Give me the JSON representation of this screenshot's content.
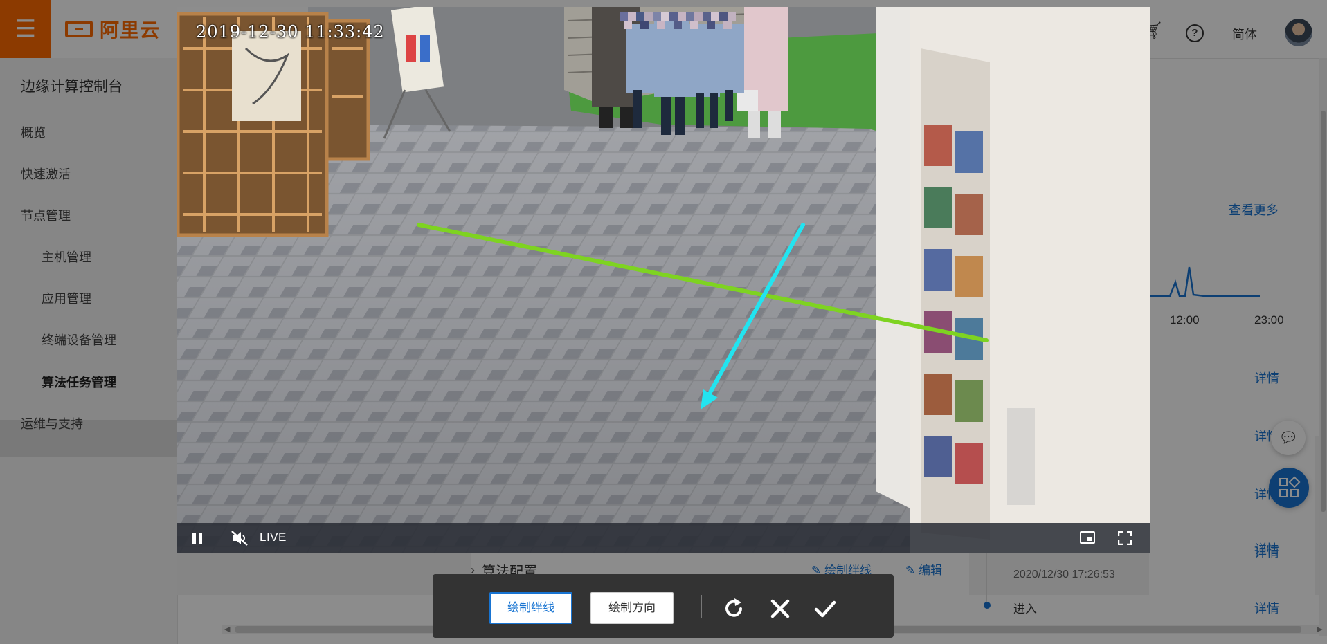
{
  "header": {
    "menu_icon": "hamburger-icon",
    "logo_text": "阿里云",
    "language": "简体",
    "cart_icon": "cart-icon",
    "help_icon": "help-icon"
  },
  "sidebar": {
    "title": "边缘计算控制台",
    "items": [
      {
        "label": "概览"
      },
      {
        "label": "快速激活"
      },
      {
        "label": "节点管理"
      },
      {
        "label": "主机管理"
      },
      {
        "label": "应用管理"
      },
      {
        "label": "终端设备管理"
      },
      {
        "label": "算法任务管理"
      },
      {
        "label": "运维与支持"
      }
    ],
    "active_item": "算法任务管理"
  },
  "right_panel": {
    "view_more": "查看更多",
    "chart_ticks": [
      "12:00",
      "23:00"
    ],
    "detail_links": [
      "详情",
      "详情",
      "详情",
      "详情",
      "详情",
      "详情"
    ],
    "timeline_timestamp": "2020/12/30 17:26:53",
    "timeline_event": "进入"
  },
  "config": {
    "section_label": "算法配置",
    "draw_tripline_link": "绘制绊线",
    "edit_link": "编辑"
  },
  "video": {
    "timestamp": "2019-12-30  11:33:42",
    "live_label": "LIVE",
    "tripline_color": "#7ed321",
    "direction_color": "#22e4f0"
  },
  "toolbar": {
    "draw_tripline": "绘制绊线",
    "draw_direction": "绘制方向",
    "active": "绘制绊线",
    "accent": "#1874d2"
  }
}
